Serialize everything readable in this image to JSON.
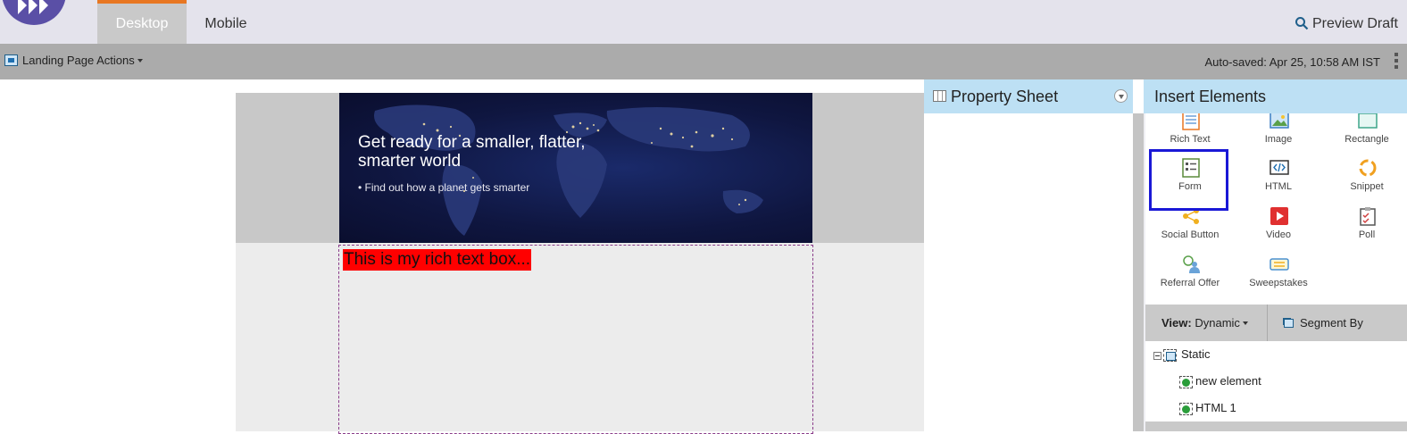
{
  "tabs": [
    {
      "label": "Desktop",
      "active": true
    },
    {
      "label": "Mobile",
      "active": false
    }
  ],
  "preview_label": "Preview Draft",
  "actions": {
    "landing_page_actions": "Landing Page Actions",
    "autosave": "Auto-saved: Apr 25, 10:58 AM IST"
  },
  "canvas": {
    "banner_heading": "Get ready for a smaller, flatter, smarter world",
    "banner_sub": "• Find out how a planet gets smarter",
    "richtext": "This is my rich text box..."
  },
  "property_sheet": {
    "title": "Property Sheet"
  },
  "insert_elements": {
    "title": "Insert Elements",
    "items": [
      {
        "label": "Rich Text",
        "icon": "rich-text-icon"
      },
      {
        "label": "Image",
        "icon": "image-icon"
      },
      {
        "label": "Rectangle",
        "icon": "rectangle-icon"
      },
      {
        "label": "Form",
        "icon": "form-icon"
      },
      {
        "label": "HTML",
        "icon": "html-icon"
      },
      {
        "label": "Snippet",
        "icon": "snippet-icon"
      },
      {
        "label": "Social Button",
        "icon": "social-button-icon"
      },
      {
        "label": "Video",
        "icon": "video-icon"
      },
      {
        "label": "Poll",
        "icon": "poll-icon"
      },
      {
        "label": "Referral Offer",
        "icon": "referral-offer-icon"
      },
      {
        "label": "Sweepstakes",
        "icon": "sweepstakes-icon"
      }
    ],
    "highlighted": "Form"
  },
  "view": {
    "label": "View:",
    "value": "Dynamic",
    "segment_label": "Segment By"
  },
  "tree": [
    {
      "label": "Static",
      "level": 0
    },
    {
      "label": "new element",
      "level": 1
    },
    {
      "label": "HTML 1",
      "level": 1
    }
  ],
  "colors": {
    "accent_tab": "#e87722",
    "logo": "#5a4fa6",
    "panel_header": "#bde0f4",
    "richtext_bg": "#ff0000",
    "highlight": "#1a18d6"
  }
}
